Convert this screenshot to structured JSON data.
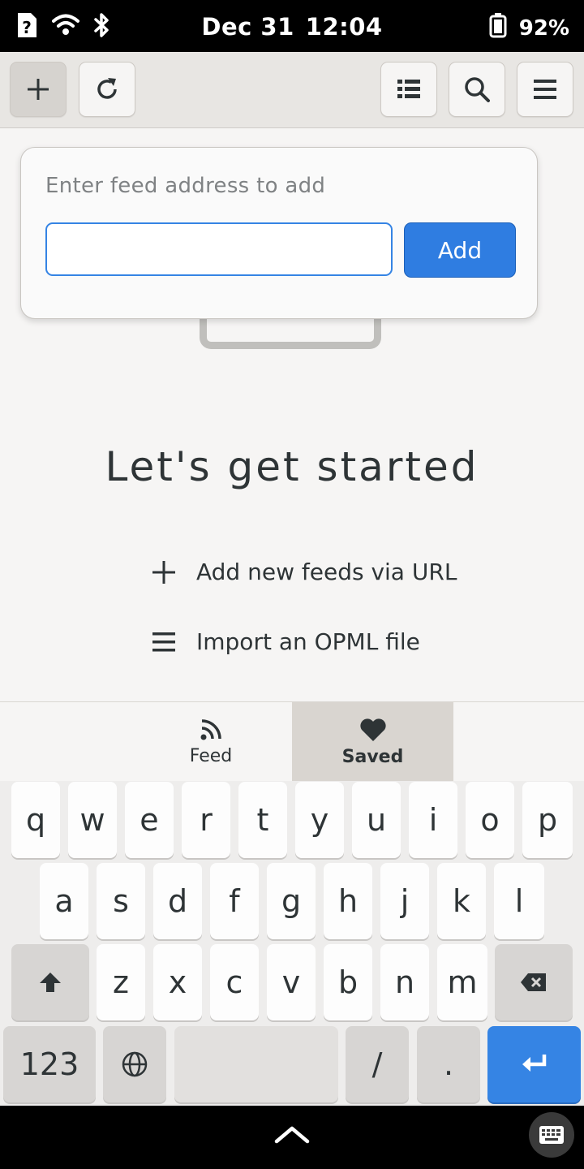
{
  "status_bar": {
    "date": "Dec 31",
    "time": "12:04",
    "battery": "92%",
    "icons": [
      "unknown-sim-icon",
      "wifi-icon",
      "bluetooth-icon",
      "battery-icon"
    ]
  },
  "header": {
    "buttons": [
      "add-icon",
      "refresh-icon",
      "list-icon",
      "search-icon",
      "menu-icon"
    ]
  },
  "popover": {
    "label": "Enter feed address to add",
    "input_value": "",
    "add_label": "Add"
  },
  "main": {
    "heading": "Let's get started",
    "actions": [
      {
        "icon": "plus-icon",
        "label": "Add new feeds via URL"
      },
      {
        "icon": "list-icon",
        "label": "Import an OPML file"
      }
    ]
  },
  "switcher": {
    "tabs": [
      {
        "icon": "rss-icon",
        "label": "Feed",
        "active": false
      },
      {
        "icon": "heart-icon",
        "label": "Saved",
        "active": true
      }
    ]
  },
  "keyboard": {
    "row1": [
      "q",
      "w",
      "e",
      "r",
      "t",
      "y",
      "u",
      "i",
      "o",
      "p"
    ],
    "row2": [
      "a",
      "s",
      "d",
      "f",
      "g",
      "h",
      "j",
      "k",
      "l"
    ],
    "row3": [
      "z",
      "x",
      "c",
      "v",
      "b",
      "n",
      "m"
    ],
    "numbers_label": "123",
    "slash": "/",
    "period": "."
  },
  "colors": {
    "accent": "#3584e4",
    "background": "#f6f5f4",
    "header": "#e8e6e3"
  }
}
